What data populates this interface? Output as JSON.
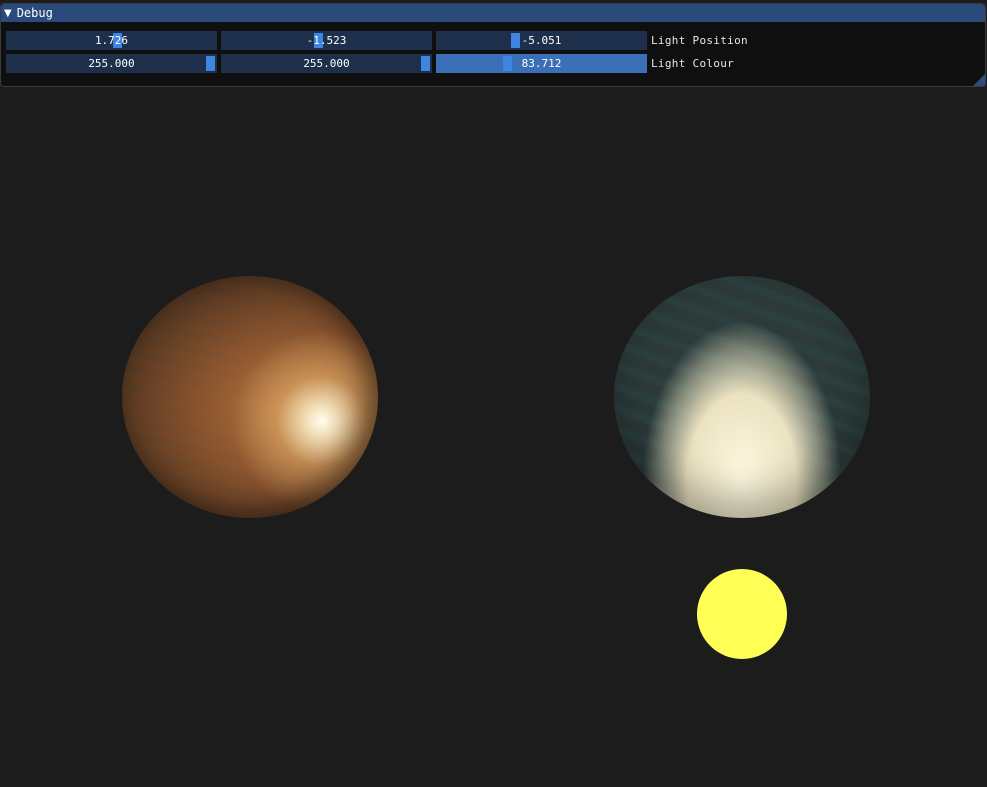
{
  "window": {
    "title": "Debug",
    "collapse_glyph": "▼"
  },
  "rows": [
    {
      "label": "Light Position",
      "values": [
        "1.726",
        "-1.523",
        "-5.051"
      ],
      "fractions": [
        0.53,
        0.46,
        0.37
      ]
    },
    {
      "label": "Light Colour",
      "values": [
        "255.000",
        "255.000",
        "83.712"
      ],
      "fractions": [
        1.0,
        1.0,
        0.33
      ]
    }
  ],
  "scene": {
    "light_color": "#ffff55",
    "background_color": "#1c1c1c",
    "accent_color": "#3d85e0",
    "title_bar_color": "#294a7a"
  }
}
